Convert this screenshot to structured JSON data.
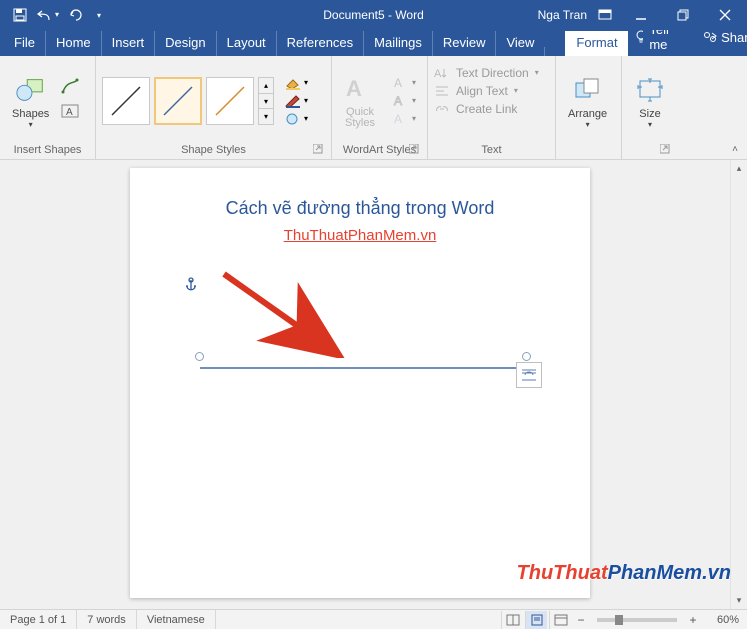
{
  "titlebar": {
    "doc_title": "Document5 - Word",
    "user_name": "Nga Tran"
  },
  "menu": {
    "file": "File",
    "home": "Home",
    "insert": "Insert",
    "design": "Design",
    "layout": "Layout",
    "references": "References",
    "mailings": "Mailings",
    "review": "Review",
    "view": "View",
    "format": "Format",
    "tell_me": "Tell me",
    "share": "Share"
  },
  "ribbon": {
    "shapes_label": "Shapes",
    "insert_shapes_group": "Insert Shapes",
    "shape_styles_group": "Shape Styles",
    "quick_styles_label": "Quick\nStyles",
    "wordart_group": "WordArt Styles",
    "text_direction": "Text Direction",
    "align_text": "Align Text",
    "create_link": "Create Link",
    "text_group": "Text",
    "arrange_label": "Arrange",
    "size_label": "Size"
  },
  "document": {
    "heading": "Cách vẽ đường thẳng trong Word",
    "link_text": "ThuThuatPhanMem.vn"
  },
  "statusbar": {
    "page": "Page 1 of 1",
    "words": "7 words",
    "language": "Vietnamese",
    "zoom": "60%"
  },
  "watermark": {
    "a": "ThuThuat",
    "b": "PhanMem",
    "c": ".vn"
  },
  "colors": {
    "brand": "#2b579a",
    "accent_red": "#e8412f",
    "line_blue": "#3e6aa3",
    "line_orange": "#d98a2b"
  }
}
